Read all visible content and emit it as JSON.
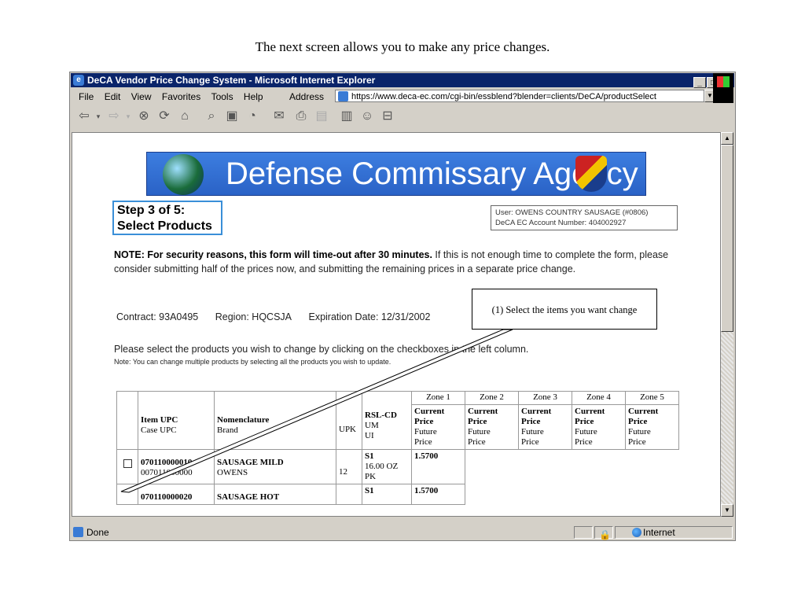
{
  "caption": "The next screen allows you to make any price changes.",
  "window": {
    "title": "DeCA Vendor Price Change System - Microsoft Internet Explorer",
    "buttons": {
      "minimize": "_",
      "maximize": "□",
      "close": "×"
    }
  },
  "menu": {
    "items": [
      "File",
      "Edit",
      "View",
      "Favorites",
      "Tools",
      "Help"
    ],
    "address_label": "Address",
    "address_url": "https://www.deca-ec.com/cgi-bin/essblend?blender=clients/DeCA/productSelect"
  },
  "toolbar": {
    "icons": [
      "back-icon",
      "forward-icon",
      "stop-icon",
      "refresh-icon",
      "home-icon",
      "search-icon",
      "favorites-icon",
      "history-icon",
      "mail-icon",
      "print-icon",
      "edit-icon",
      "discuss-icon",
      "messenger-icon"
    ]
  },
  "page": {
    "banner_title": "Defense Commissary Agency",
    "step_line1": "Step 3 of 5:",
    "step_line2": "Select Products",
    "user_line": "User: OWENS COUNTRY SAUSAGE (#0806)",
    "account_line": "DeCA EC Account Number: 404002927",
    "note_bold": "NOTE: For security reasons, this form will time-out after 30 minutes.",
    "note_rest": " If this is not enough time to complete the form, please consider submitting half of the prices now, and submitting the remaining prices in a separate price change.",
    "contract": "Contract: 93A0495",
    "region": "Region: HQCSJA",
    "expiration": "Expiration Date:  12/31/2002",
    "callout": "(1)  Select the items you want change",
    "select_text": "Please select the products you wish to change by clicking on the checkboxes in the left column.",
    "select_note": "Note: You can change multiple products by selecting all the products you wish to update."
  },
  "table": {
    "zones": [
      "Zone 1",
      "Zone 2",
      "Zone 3",
      "Zone 4",
      "Zone 5"
    ],
    "header": {
      "upc_bold": "Item UPC",
      "upc_sub": "Case UPC",
      "nom_bold": "Nomenclature",
      "nom_sub": "Brand",
      "upk": "UPK",
      "rsl_bold": "RSL-CD",
      "rsl_sub1": "UM",
      "rsl_sub2": "UI",
      "price_bold1": "Current",
      "price_bold2": "Price",
      "price_sub1": "Future",
      "price_sub2": "Price"
    },
    "rows": [
      {
        "item_upc": "070110000010",
        "case_upc": "007011000000",
        "nomenclature": "SAUSAGE MILD",
        "brand": "OWENS",
        "upk": "12",
        "rsl": "S1",
        "um": "16.00 OZ",
        "ui": "PK",
        "price": "1.5700"
      },
      {
        "item_upc": "070110000020",
        "case_upc": "",
        "nomenclature": "SAUSAGE HOT",
        "brand": "",
        "upk": "",
        "rsl": "S1",
        "um": "",
        "ui": "",
        "price": "1.5700"
      }
    ]
  },
  "status": {
    "text": "Done",
    "zone": "Internet"
  }
}
